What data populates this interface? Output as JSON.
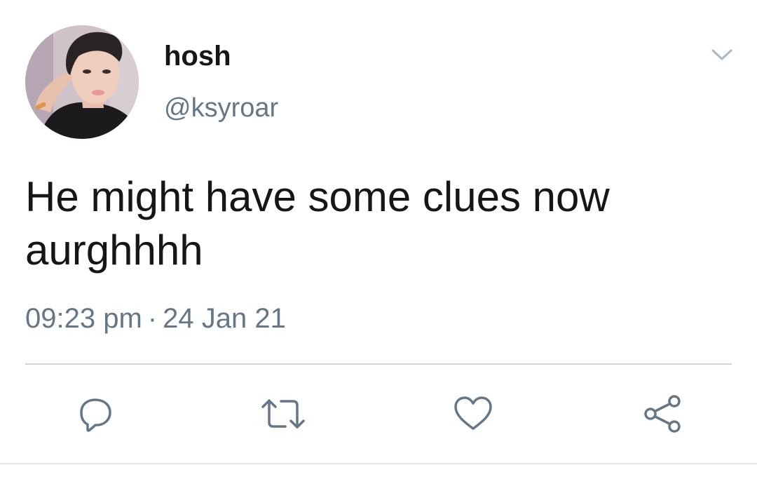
{
  "tweet": {
    "display_name": "hosh",
    "handle": "@ksyroar",
    "text_line1": "He might have some clues now",
    "text_line2": "aurghhhh",
    "time": "09:23 pm",
    "date": "24 Jan 21",
    "separator": "·"
  },
  "icons": {
    "menu": "chevron-down-icon",
    "reply": "reply-icon",
    "retweet": "retweet-icon",
    "like": "heart-icon",
    "share": "share-icon"
  },
  "colors": {
    "text": "#14171a",
    "secondary": "#657786",
    "divider": "#ccd6dd",
    "icon": "#657786",
    "caret": "#aab8c2"
  }
}
